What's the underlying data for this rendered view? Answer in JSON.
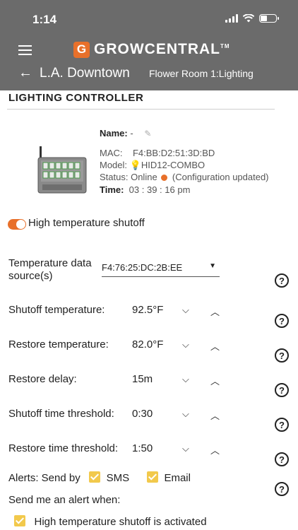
{
  "status_bar": {
    "time": "1:14"
  },
  "header": {
    "logo_mark": "G",
    "logo_text": "GROWCENTRAL",
    "logo_tm": "TM",
    "location": "L.A. Downtown",
    "room": "Flower Room 1:Lighting"
  },
  "section_title": "LIGHTING CONTROLLER",
  "device": {
    "name_label": "Name:",
    "name_value": "-",
    "mac_label": "MAC:",
    "mac_value": "F4:BB:D2:51:3D:BD",
    "model_label": "Model:",
    "model_value": "HID12-COMBO",
    "status_label": "Status:",
    "status_value": "Online",
    "status_note": "(Configuration updated)",
    "time_label": "Time:",
    "time_value": "03 : 39 : 16 pm"
  },
  "shutoff_toggle": {
    "label": "High temperature shutoff",
    "enabled": true
  },
  "temp_source": {
    "label_line1": "Temperature data",
    "label_line2": "source(s)",
    "selected": "F4:76:25:DC:2B:EE"
  },
  "settings": [
    {
      "label": "Shutoff temperature:",
      "value": "92.5°F"
    },
    {
      "label": "Restore temperature:",
      "value": "82.0°F"
    },
    {
      "label": "Restore delay:",
      "value": "15m"
    },
    {
      "label": "Shutoff time threshold:",
      "value": "0:30"
    },
    {
      "label": "Restore time threshold:",
      "value": "1:50"
    }
  ],
  "alerts": {
    "send_by_label": "Alerts: Send by",
    "sms_label": "SMS",
    "sms_checked": true,
    "email_label": "Email",
    "email_checked": true,
    "when_label": "Send me an alert when:",
    "activated_label": "High temperature shutoff is activated",
    "activated_checked": true
  },
  "colors": {
    "header_bg": "#6b6b6b",
    "accent": "#e8702a",
    "checkbox": "#f2c94c"
  },
  "icons": {
    "help": "?",
    "up": "⌃",
    "down": "⌄"
  }
}
